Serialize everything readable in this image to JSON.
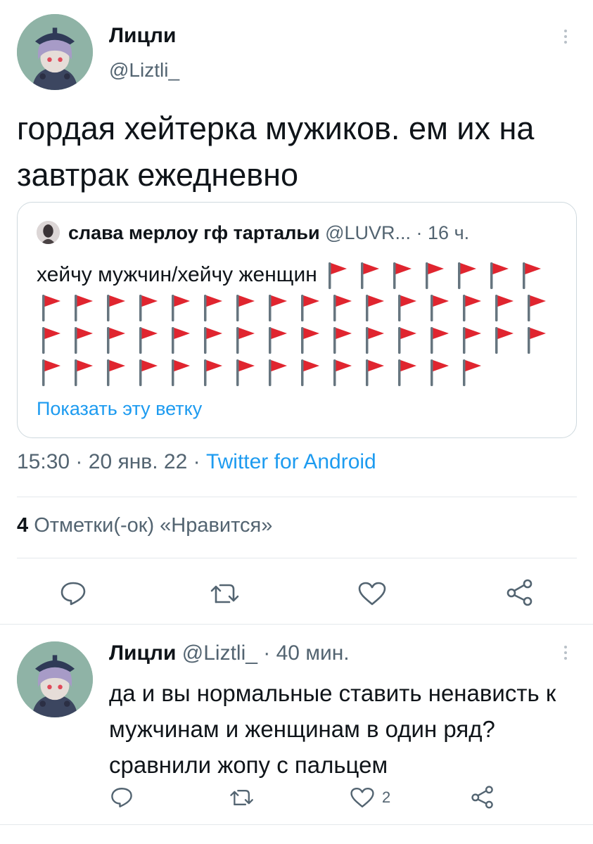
{
  "tweet": {
    "author_name": "Лицли",
    "author_handle": "@Liztli_",
    "text": "гордая хейтерка мужиков. ем их на завтрак ежедневно",
    "quote": {
      "name": "слава мерлоу гф тартальи",
      "handle": "@LUVR...",
      "time": "16 ч.",
      "text": "хейчу мужчин/хейчу женщин",
      "flag_emoji": "🚩",
      "flag_count": 53,
      "show_thread": "Показать эту ветку"
    },
    "time": "15:30",
    "date": "20 янв. 22",
    "source": "Twitter for Android",
    "likes_count": "4",
    "likes_label": "Отметки(-ок) «Нравится»",
    "actions": [
      "reply-icon",
      "retweet-icon",
      "like-icon",
      "share-icon"
    ]
  },
  "reply": {
    "author_name": "Лицли",
    "author_handle": "@Liztli_",
    "time": "40 мин.",
    "text": "да и вы нормальные ставить ненависть к мужчинам и женщинам в один ряд? сравнили жопу с пальцем",
    "like_count": "2",
    "actions": [
      "reply-icon",
      "retweet-icon",
      "like-icon",
      "share-icon"
    ]
  },
  "colors": {
    "link": "#1d9bf0",
    "muted": "#536471",
    "text": "#0f1419",
    "border": "#cfd9de",
    "flag": "#e0252f"
  },
  "dot": "·"
}
